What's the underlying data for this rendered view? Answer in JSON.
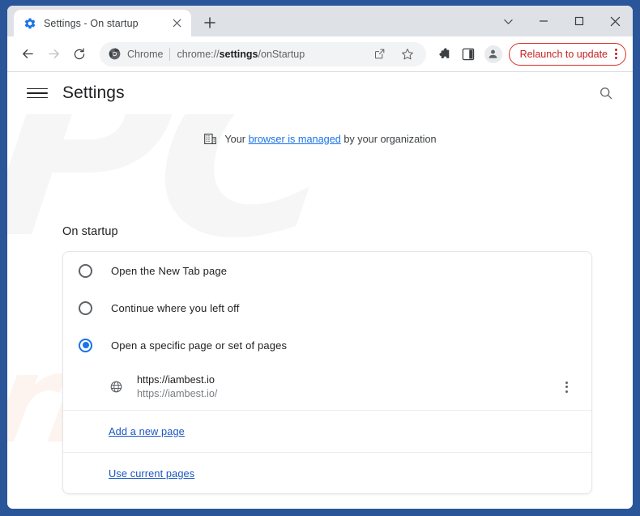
{
  "window": {
    "controls": [
      {
        "name": "tab-search",
        "glyph": "chevron-down"
      },
      {
        "name": "minimize",
        "glyph": "minimize"
      },
      {
        "name": "maximize",
        "glyph": "maximize"
      },
      {
        "name": "close",
        "glyph": "close"
      }
    ],
    "frame_color": "#2a5699"
  },
  "tabstrip": {
    "tab": {
      "title": "Settings - On startup",
      "favicon": "settings-gear-icon",
      "close_label": "Close tab"
    },
    "new_tab_label": "New tab"
  },
  "toolbar": {
    "back_label": "Back",
    "forward_label": "Forward",
    "reload_label": "Reload",
    "omnibox": {
      "brand_label": "Chrome",
      "brand_icon": "chrome-icon",
      "url_prefix": "chrome://",
      "url_strong": "settings",
      "url_suffix": "/onStartup",
      "share_label": "Share this page",
      "bookmark_label": "Bookmark this tab"
    },
    "extensions_label": "Extensions",
    "side_panel_label": "Side panel",
    "profile_label": "Profile",
    "relaunch_label": "Relaunch to update",
    "relaunch_color": "#c5221f",
    "menu_label": "Customize and control Google Chrome"
  },
  "settings": {
    "title": "Settings",
    "menu_label": "Main menu",
    "search_label": "Search settings",
    "managed_banner": {
      "prefix": "Your ",
      "link": "browser is managed",
      "suffix": " by your organization",
      "icon": "enterprise-building-icon"
    },
    "section_title": "On startup",
    "options": [
      {
        "label": "Open the New Tab page",
        "selected": false
      },
      {
        "label": "Continue where you left off",
        "selected": false
      },
      {
        "label": "Open a specific page or set of pages",
        "selected": true
      }
    ],
    "pages": [
      {
        "title": "https://iambest.io",
        "url": "https://iambest.io/",
        "icon": "globe-icon",
        "more_label": "More actions"
      }
    ],
    "links": [
      {
        "label": "Add a new page"
      },
      {
        "label": "Use current pages"
      }
    ],
    "accent_color": "#1a73e8",
    "link_color": "#1a56c4"
  },
  "watermark": {
    "top_text": "PC",
    "bottom_text": "risk.com"
  }
}
